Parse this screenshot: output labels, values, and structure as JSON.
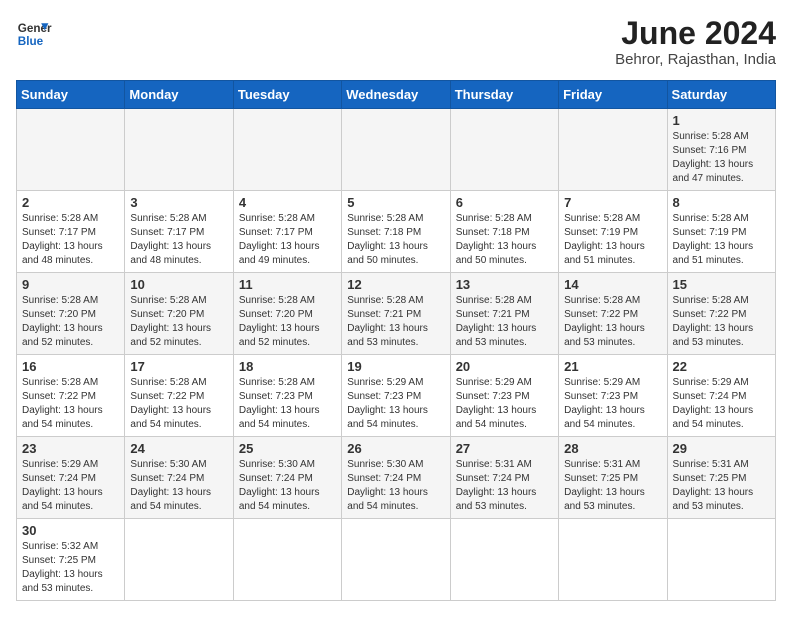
{
  "logo": {
    "text_general": "General",
    "text_blue": "Blue"
  },
  "header": {
    "month_year": "June 2024",
    "location": "Behror, Rajasthan, India"
  },
  "weekdays": [
    "Sunday",
    "Monday",
    "Tuesday",
    "Wednesday",
    "Thursday",
    "Friday",
    "Saturday"
  ],
  "weeks": [
    [
      {
        "day": "",
        "info": ""
      },
      {
        "day": "",
        "info": ""
      },
      {
        "day": "",
        "info": ""
      },
      {
        "day": "",
        "info": ""
      },
      {
        "day": "",
        "info": ""
      },
      {
        "day": "",
        "info": ""
      },
      {
        "day": "1",
        "info": "Sunrise: 5:28 AM\nSunset: 7:16 PM\nDaylight: 13 hours and 47 minutes."
      }
    ],
    [
      {
        "day": "2",
        "info": "Sunrise: 5:28 AM\nSunset: 7:17 PM\nDaylight: 13 hours and 48 minutes."
      },
      {
        "day": "3",
        "info": "Sunrise: 5:28 AM\nSunset: 7:17 PM\nDaylight: 13 hours and 48 minutes."
      },
      {
        "day": "4",
        "info": "Sunrise: 5:28 AM\nSunset: 7:17 PM\nDaylight: 13 hours and 49 minutes."
      },
      {
        "day": "5",
        "info": "Sunrise: 5:28 AM\nSunset: 7:18 PM\nDaylight: 13 hours and 50 minutes."
      },
      {
        "day": "6",
        "info": "Sunrise: 5:28 AM\nSunset: 7:18 PM\nDaylight: 13 hours and 50 minutes."
      },
      {
        "day": "7",
        "info": "Sunrise: 5:28 AM\nSunset: 7:19 PM\nDaylight: 13 hours and 51 minutes."
      },
      {
        "day": "8",
        "info": "Sunrise: 5:28 AM\nSunset: 7:19 PM\nDaylight: 13 hours and 51 minutes."
      }
    ],
    [
      {
        "day": "9",
        "info": "Sunrise: 5:28 AM\nSunset: 7:20 PM\nDaylight: 13 hours and 52 minutes."
      },
      {
        "day": "10",
        "info": "Sunrise: 5:28 AM\nSunset: 7:20 PM\nDaylight: 13 hours and 52 minutes."
      },
      {
        "day": "11",
        "info": "Sunrise: 5:28 AM\nSunset: 7:20 PM\nDaylight: 13 hours and 52 minutes."
      },
      {
        "day": "12",
        "info": "Sunrise: 5:28 AM\nSunset: 7:21 PM\nDaylight: 13 hours and 53 minutes."
      },
      {
        "day": "13",
        "info": "Sunrise: 5:28 AM\nSunset: 7:21 PM\nDaylight: 13 hours and 53 minutes."
      },
      {
        "day": "14",
        "info": "Sunrise: 5:28 AM\nSunset: 7:22 PM\nDaylight: 13 hours and 53 minutes."
      },
      {
        "day": "15",
        "info": "Sunrise: 5:28 AM\nSunset: 7:22 PM\nDaylight: 13 hours and 53 minutes."
      }
    ],
    [
      {
        "day": "16",
        "info": "Sunrise: 5:28 AM\nSunset: 7:22 PM\nDaylight: 13 hours and 54 minutes."
      },
      {
        "day": "17",
        "info": "Sunrise: 5:28 AM\nSunset: 7:22 PM\nDaylight: 13 hours and 54 minutes."
      },
      {
        "day": "18",
        "info": "Sunrise: 5:28 AM\nSunset: 7:23 PM\nDaylight: 13 hours and 54 minutes."
      },
      {
        "day": "19",
        "info": "Sunrise: 5:29 AM\nSunset: 7:23 PM\nDaylight: 13 hours and 54 minutes."
      },
      {
        "day": "20",
        "info": "Sunrise: 5:29 AM\nSunset: 7:23 PM\nDaylight: 13 hours and 54 minutes."
      },
      {
        "day": "21",
        "info": "Sunrise: 5:29 AM\nSunset: 7:23 PM\nDaylight: 13 hours and 54 minutes."
      },
      {
        "day": "22",
        "info": "Sunrise: 5:29 AM\nSunset: 7:24 PM\nDaylight: 13 hours and 54 minutes."
      }
    ],
    [
      {
        "day": "23",
        "info": "Sunrise: 5:29 AM\nSunset: 7:24 PM\nDaylight: 13 hours and 54 minutes."
      },
      {
        "day": "24",
        "info": "Sunrise: 5:30 AM\nSunset: 7:24 PM\nDaylight: 13 hours and 54 minutes."
      },
      {
        "day": "25",
        "info": "Sunrise: 5:30 AM\nSunset: 7:24 PM\nDaylight: 13 hours and 54 minutes."
      },
      {
        "day": "26",
        "info": "Sunrise: 5:30 AM\nSunset: 7:24 PM\nDaylight: 13 hours and 54 minutes."
      },
      {
        "day": "27",
        "info": "Sunrise: 5:31 AM\nSunset: 7:24 PM\nDaylight: 13 hours and 53 minutes."
      },
      {
        "day": "28",
        "info": "Sunrise: 5:31 AM\nSunset: 7:25 PM\nDaylight: 13 hours and 53 minutes."
      },
      {
        "day": "29",
        "info": "Sunrise: 5:31 AM\nSunset: 7:25 PM\nDaylight: 13 hours and 53 minutes."
      }
    ],
    [
      {
        "day": "30",
        "info": "Sunrise: 5:32 AM\nSunset: 7:25 PM\nDaylight: 13 hours and 53 minutes."
      },
      {
        "day": "",
        "info": ""
      },
      {
        "day": "",
        "info": ""
      },
      {
        "day": "",
        "info": ""
      },
      {
        "day": "",
        "info": ""
      },
      {
        "day": "",
        "info": ""
      },
      {
        "day": "",
        "info": ""
      }
    ]
  ]
}
